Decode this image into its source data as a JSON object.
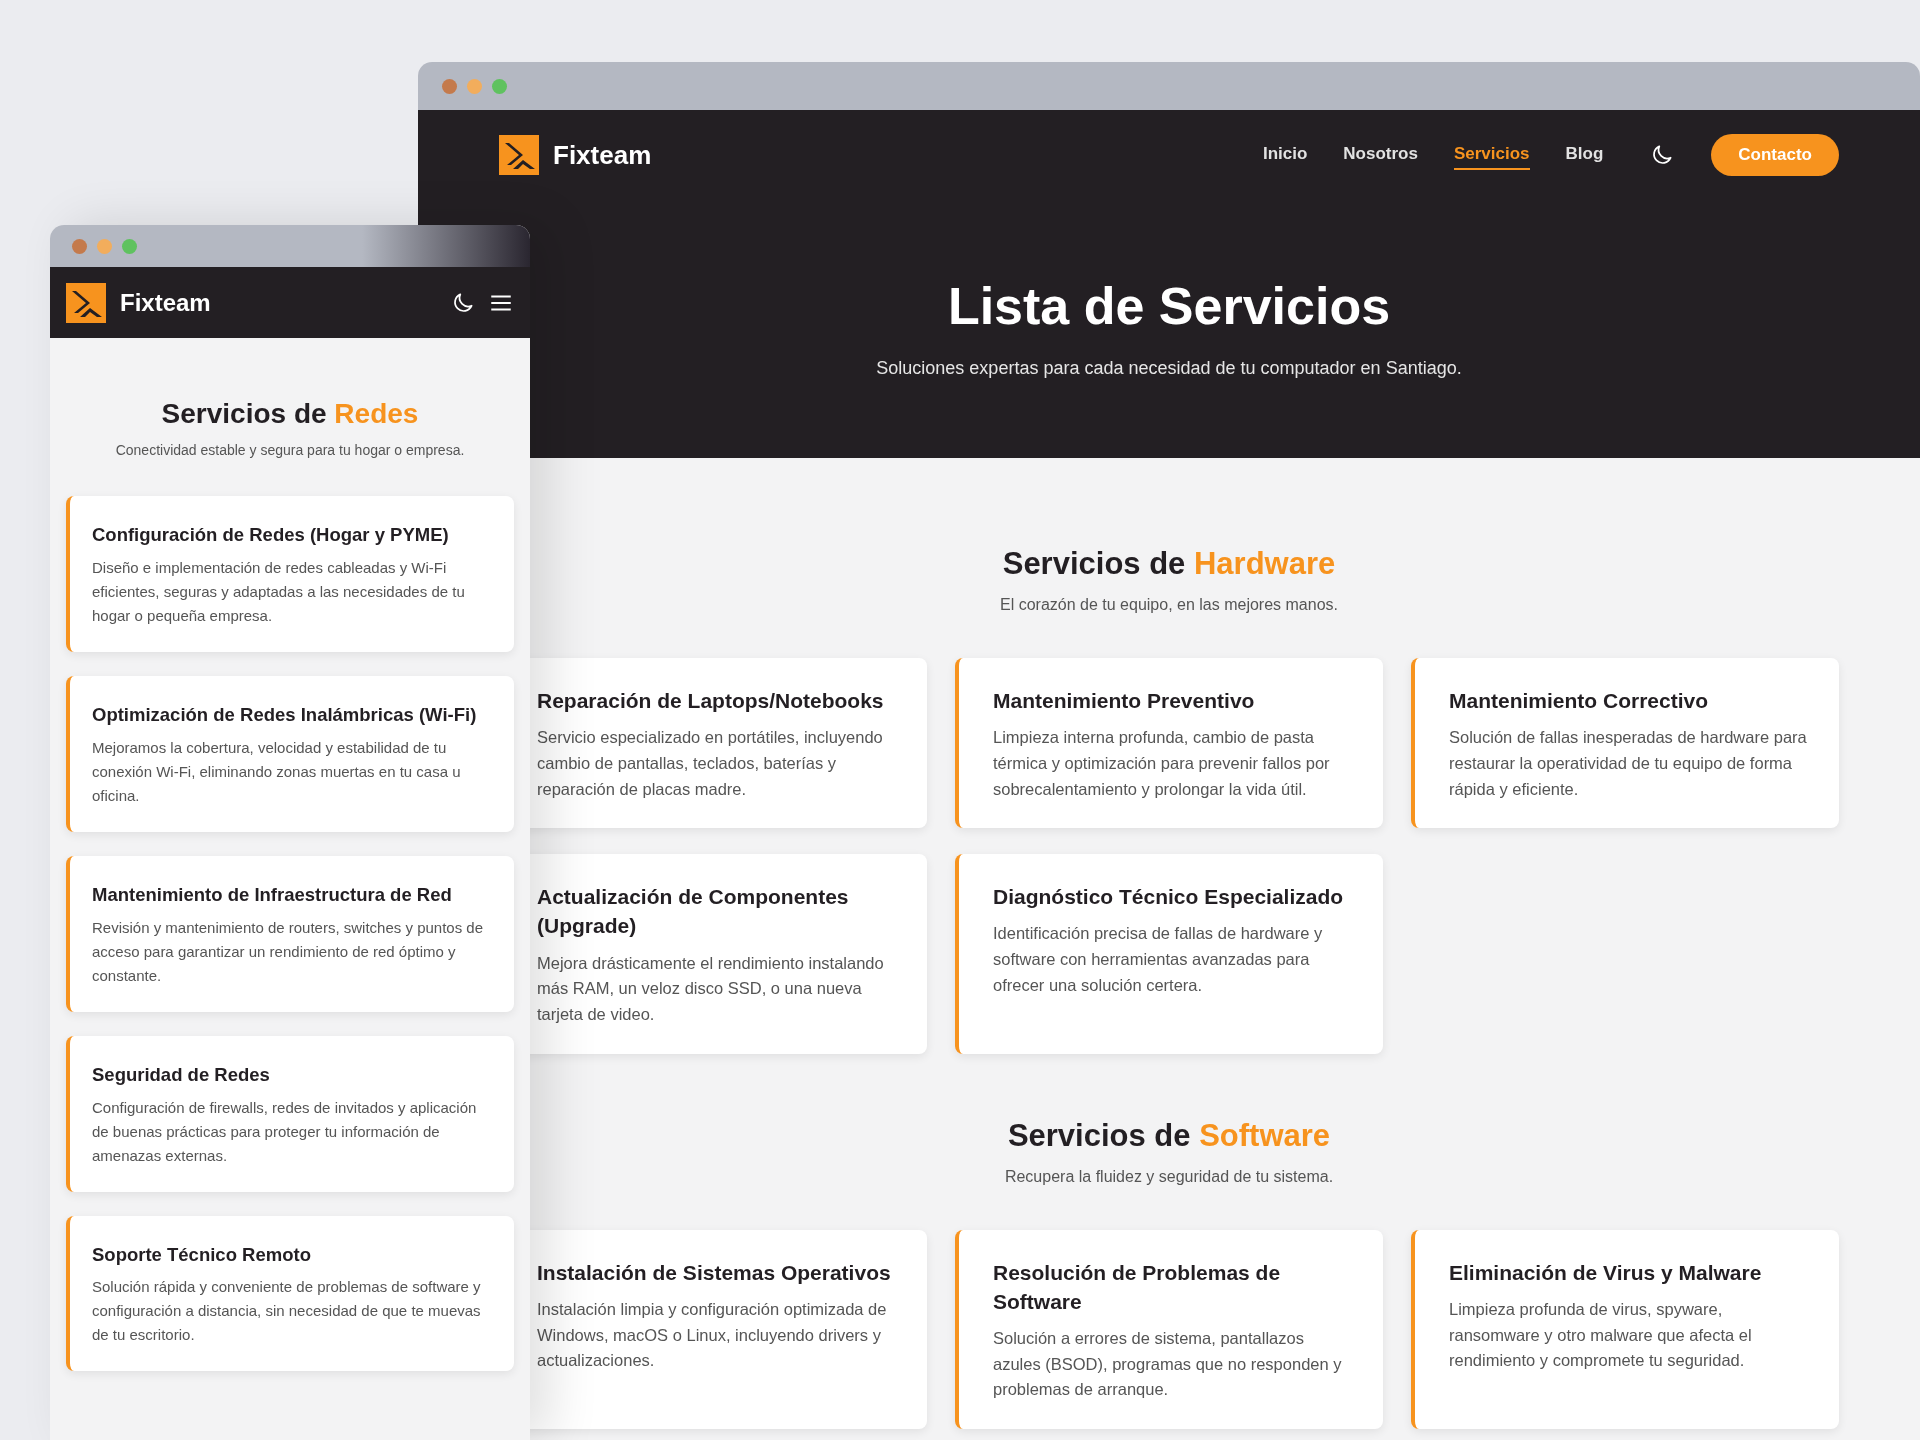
{
  "desktop_window": {
    "nav": {
      "brand": "Fixteam",
      "links": [
        {
          "label": "Inicio",
          "selected": false
        },
        {
          "label": "Nosotros",
          "selected": false
        },
        {
          "label": "Servicios",
          "selected": true
        },
        {
          "label": "Blog",
          "selected": false
        }
      ],
      "button": "Contacto"
    },
    "hero": {
      "title": "Lista de Servicios",
      "subtitle": "Soluciones expertas para cada necesidad de tu computador en Santiago."
    },
    "sections": [
      {
        "title": "Servicios de",
        "highlight": "Hardware",
        "subtitle": "El corazón de tu equipo, en las mejores manos.",
        "cards": [
          {
            "title": "Reparación de Laptops/Notebooks",
            "description": "Servicio especializado en portátiles, incluyendo cambio de pantallas, teclados, baterías y reparación de placas madre."
          },
          {
            "title": "Mantenimiento Preventivo",
            "description": "Limpieza interna profunda, cambio de pasta térmica y optimización para prevenir fallos por sobrecalentamiento y prolongar la vida útil."
          },
          {
            "title": "Mantenimiento Correctivo",
            "description": "Solución de fallas inesperadas de hardware para restaurar la operatividad de tu equipo de forma rápida y eficiente."
          },
          {
            "title": "Actualización de Componentes (Upgrade)",
            "description": "Mejora drásticamente el rendimiento instalando más RAM, un veloz disco SSD, o una nueva tarjeta de video."
          },
          {
            "title": "Diagnóstico Técnico Especializado",
            "description": "Identificación precisa de fallas de hardware y software con herramientas avanzadas para ofrecer una solución certera."
          }
        ]
      },
      {
        "title": "Servicios de",
        "highlight": "Software",
        "subtitle": "Recupera la fluidez y seguridad de tu sistema.",
        "cards": [
          {
            "title": "Instalación de Sistemas Operativos",
            "description": "Instalación limpia y configuración optimizada de Windows, macOS o Linux, incluyendo drivers y actualizaciones."
          },
          {
            "title": "Resolución de Problemas de Software",
            "description": "Solución a errores de sistema, pantallazos azules (BSOD), programas que no responden y problemas de arranque."
          },
          {
            "title": "Eliminación de Virus y Malware",
            "description": "Limpieza profunda de virus, spyware, ransomware y otro malware que afecta el rendimiento y compromete tu seguridad."
          }
        ]
      }
    ]
  },
  "mobile_window": {
    "brand": "Fixteam",
    "section": {
      "title": "Servicios de",
      "highlight": "Redes",
      "subtitle": "Conectividad estable y segura para tu hogar o empresa.",
      "cards": [
        {
          "title": "Configuración de Redes (Hogar y PYME)",
          "description": "Diseño e implementación de redes cableadas y Wi-Fi eficientes, seguras y adaptadas a las necesidades de tu hogar o pequeña empresa."
        },
        {
          "title": "Optimización de Redes Inalámbricas (Wi-Fi)",
          "description": "Mejoramos la cobertura, velocidad y estabilidad de tu conexión Wi-Fi, eliminando zonas muertas en tu casa u oficina."
        },
        {
          "title": "Mantenimiento de Infraestructura de Red",
          "description": "Revisión y mantenimiento de routers, switches y puntos de acceso para garantizar un rendimiento de red óptimo y constante."
        },
        {
          "title": "Seguridad de Redes",
          "description": "Configuración de firewalls, redes de invitados y aplicación de buenas prácticas para proteger tu información de amenazas externas."
        },
        {
          "title": "Soporte Técnico Remoto",
          "description": "Solución rápida y conveniente de problemas de software y configuración a distancia, sin necesidad de que te muevas de tu escritorio."
        }
      ]
    }
  }
}
